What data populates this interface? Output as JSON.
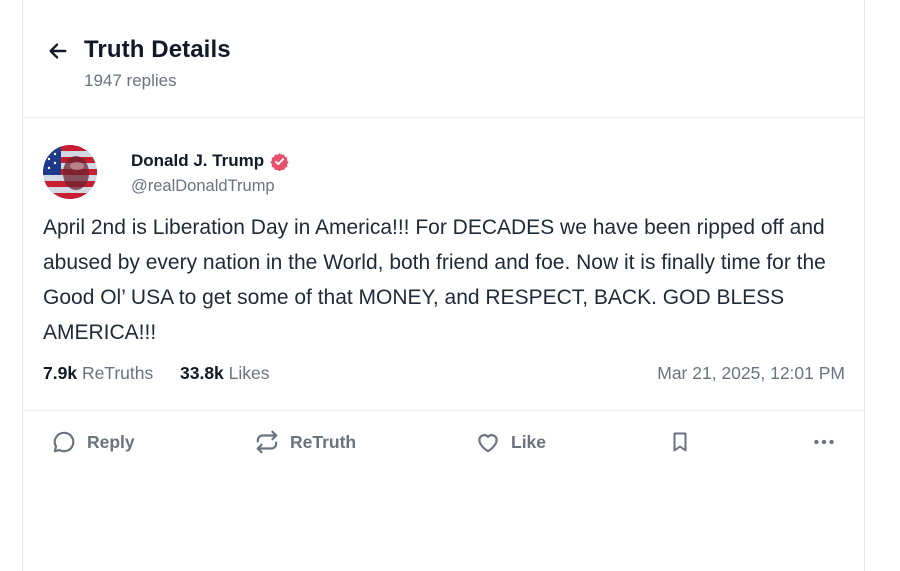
{
  "header": {
    "title": "Truth Details",
    "reply_count": "1947 replies"
  },
  "post": {
    "author_name": "Donald J. Trump",
    "author_handle": "@realDonaldTrump",
    "verified": true,
    "body": "April 2nd is Liberation Day in America!!! For DECADES we have been ripped off and abused by every nation in the World, both friend and foe. Now it is finally time for the Good Ol’ USA to get some of that MONEY, and RESPECT, BACK. GOD BLESS AMERICA!!!",
    "retruths_count": "7.9k",
    "retruths_label": "ReTruths",
    "likes_count": "33.8k",
    "likes_label": "Likes",
    "timestamp": "Mar 21, 2025, 12:01 PM"
  },
  "actions": {
    "reply": "Reply",
    "retruth": "ReTruth",
    "like": "Like"
  },
  "icons": {
    "back": "arrow-left-icon",
    "verified": "verified-badge-icon",
    "reply": "speech-bubble-icon",
    "retruth": "repost-arrows-icon",
    "like": "heart-icon",
    "bookmark": "bookmark-icon",
    "more": "ellipsis-icon"
  },
  "colors": {
    "verified_badge": "#e8506b",
    "muted_text": "#6b7280",
    "title_text": "#111827"
  }
}
